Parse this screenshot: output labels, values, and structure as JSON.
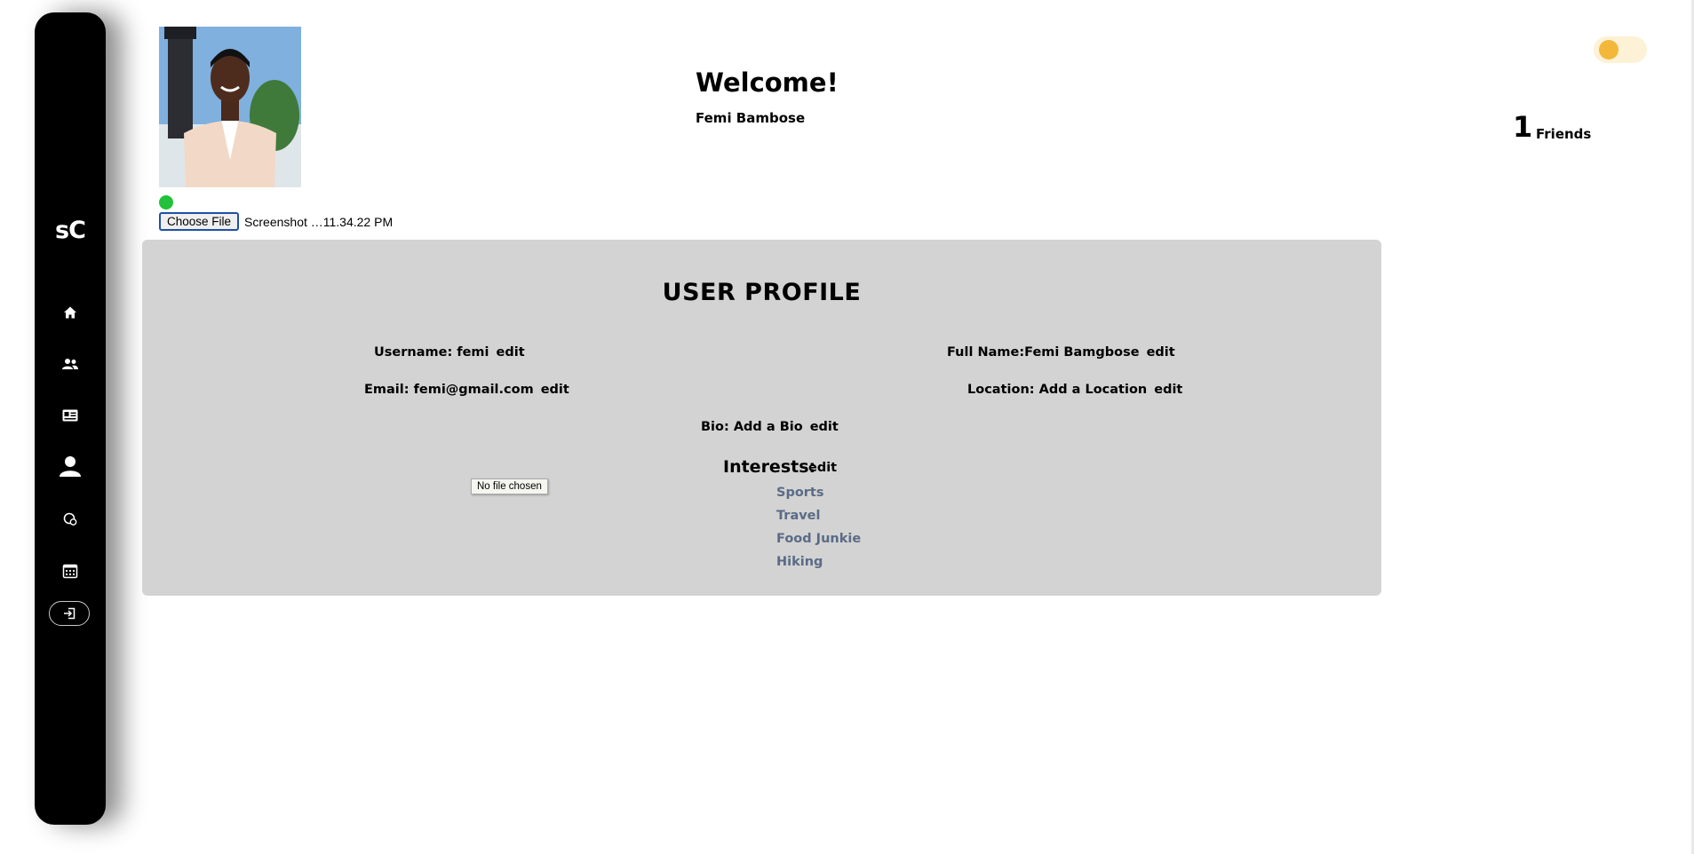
{
  "app": {
    "logo": "sC"
  },
  "sidebar": {
    "icons": [
      "home-icon",
      "friends-icon",
      "card-icon",
      "user-icon",
      "chat-icon",
      "calendar-icon",
      "logout-icon"
    ]
  },
  "header": {
    "welcome": "Welcome!",
    "user_name": "Femi Bambose",
    "friends_count": "1",
    "friends_label": "Friends"
  },
  "upload": {
    "button_label": "Choose File",
    "file_name": "Screenshot …11.34.22 PM",
    "tooltip": "No file chosen"
  },
  "profile": {
    "title": "USER PROFILE",
    "username": "Username: femi",
    "full_name": "Full Name:Femi Bamgbose",
    "email": "Email: femi@gmail.com",
    "location": "Location: Add a Location",
    "bio": "Bio: Add a Bio",
    "edit_label": "edit",
    "interests_title": "Interests:",
    "interests": [
      "Sports",
      "Travel",
      "Food Junkie",
      "Hiking"
    ]
  },
  "colors": {
    "sidebar_bg": "#000000",
    "card_bg": "#d3d3d3",
    "status_online": "#22c13a",
    "toggle_bg": "#fdf1d6",
    "toggle_knob": "#f3b73a",
    "interest_text": "#5a6b86"
  }
}
